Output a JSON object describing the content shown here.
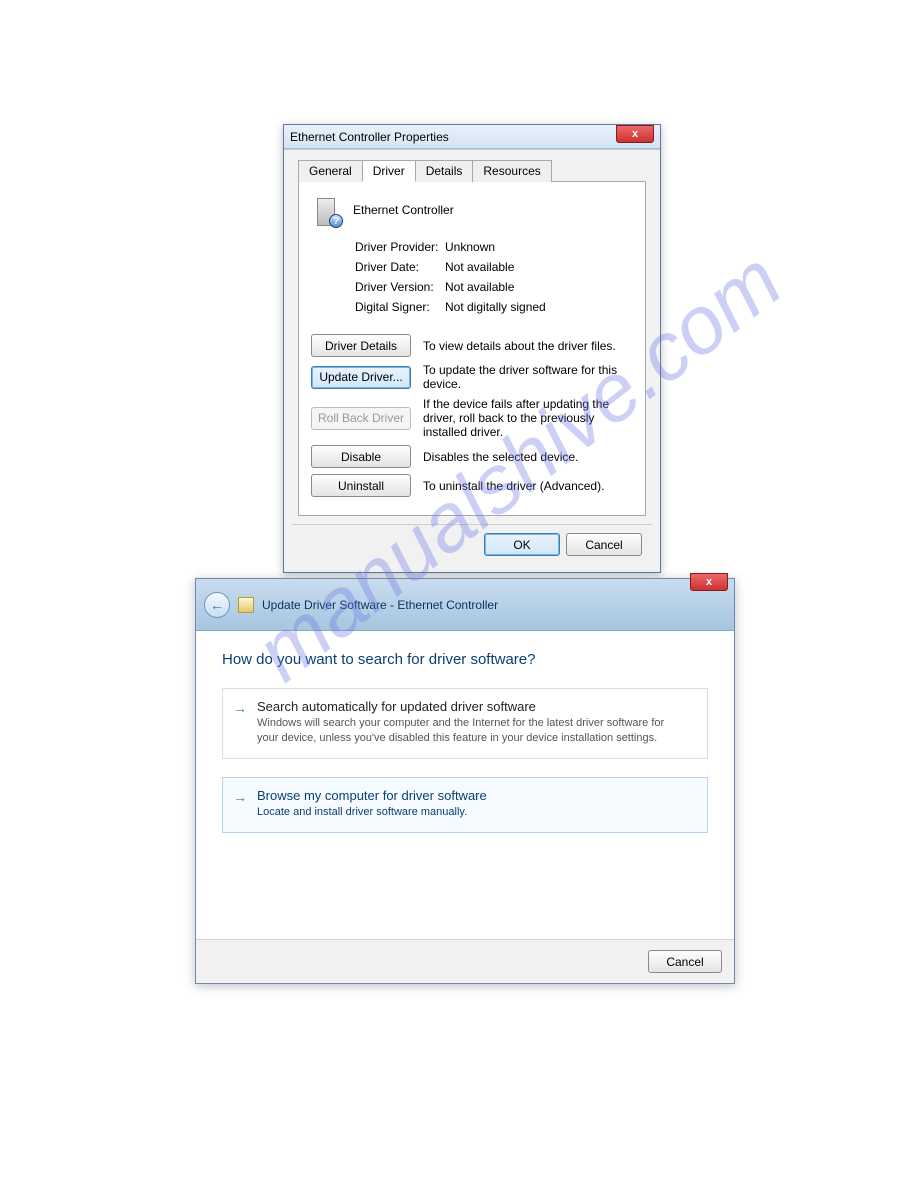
{
  "watermark": "manualshive.com",
  "win1": {
    "title": "Ethernet Controller Properties",
    "close_glyph": "x",
    "tabs": {
      "general": "General",
      "driver": "Driver",
      "details": "Details",
      "resources": "Resources"
    },
    "device_name": "Ethernet Controller",
    "info": {
      "provider_label": "Driver Provider:",
      "provider_value": "Unknown",
      "date_label": "Driver Date:",
      "date_value": "Not available",
      "version_label": "Driver Version:",
      "version_value": "Not available",
      "signer_label": "Digital Signer:",
      "signer_value": "Not digitally signed"
    },
    "buttons": {
      "details": "Driver Details",
      "details_desc": "To view details about the driver files.",
      "update": "Update Driver...",
      "update_desc": "To update the driver software for this device.",
      "rollback": "Roll Back Driver",
      "rollback_desc": "If the device fails after updating the driver, roll back to the previously installed driver.",
      "disable": "Disable",
      "disable_desc": "Disables the selected device.",
      "uninstall": "Uninstall",
      "uninstall_desc": "To uninstall the driver (Advanced)."
    },
    "footer": {
      "ok": "OK",
      "cancel": "Cancel"
    }
  },
  "win2": {
    "close_glyph": "x",
    "back_glyph": "←",
    "title": "Update Driver Software - Ethernet Controller",
    "heading": "How do you want to search for driver software?",
    "opt1_title": "Search automatically for updated driver software",
    "opt1_sub": "Windows will search your computer and the Internet for the latest driver software for your device, unless you've disabled this feature in your device installation settings.",
    "opt2_title": "Browse my computer for driver software",
    "opt2_sub": "Locate and install driver software manually.",
    "arrow": "→",
    "cancel": "Cancel"
  }
}
